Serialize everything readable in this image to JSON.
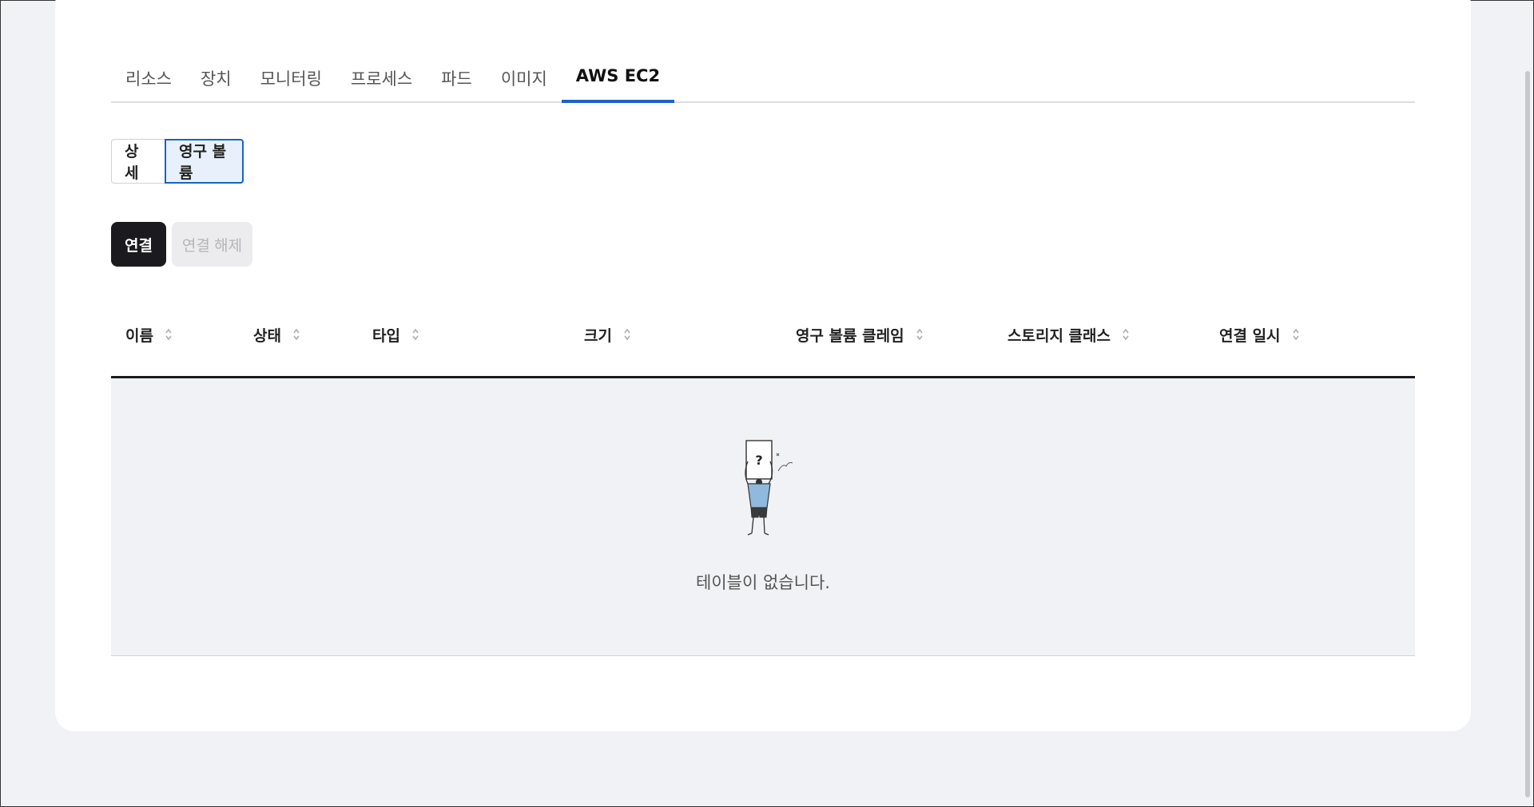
{
  "tabs": [
    {
      "label": "리소스"
    },
    {
      "label": "장치"
    },
    {
      "label": "모니터링"
    },
    {
      "label": "프로세스"
    },
    {
      "label": "파드"
    },
    {
      "label": "이미지"
    },
    {
      "label": "AWS EC2",
      "active": true
    }
  ],
  "segment": {
    "detail_label": "상세",
    "volume_label": "영구 볼륨",
    "selected": "영구 볼륨"
  },
  "actions": {
    "connect_label": "연결",
    "disconnect_label": "연결 해제"
  },
  "table": {
    "columns": [
      "이름",
      "상태",
      "타입",
      "크기",
      "영구 볼륨 클레임",
      "스토리지 클래스",
      "연결 일시"
    ],
    "rows": [],
    "empty_text": "테이블이 없습니다."
  },
  "colors": {
    "accent": "#1a62c5",
    "primary_button": "#1b1b1f",
    "page_background": "#f1f2f5"
  }
}
